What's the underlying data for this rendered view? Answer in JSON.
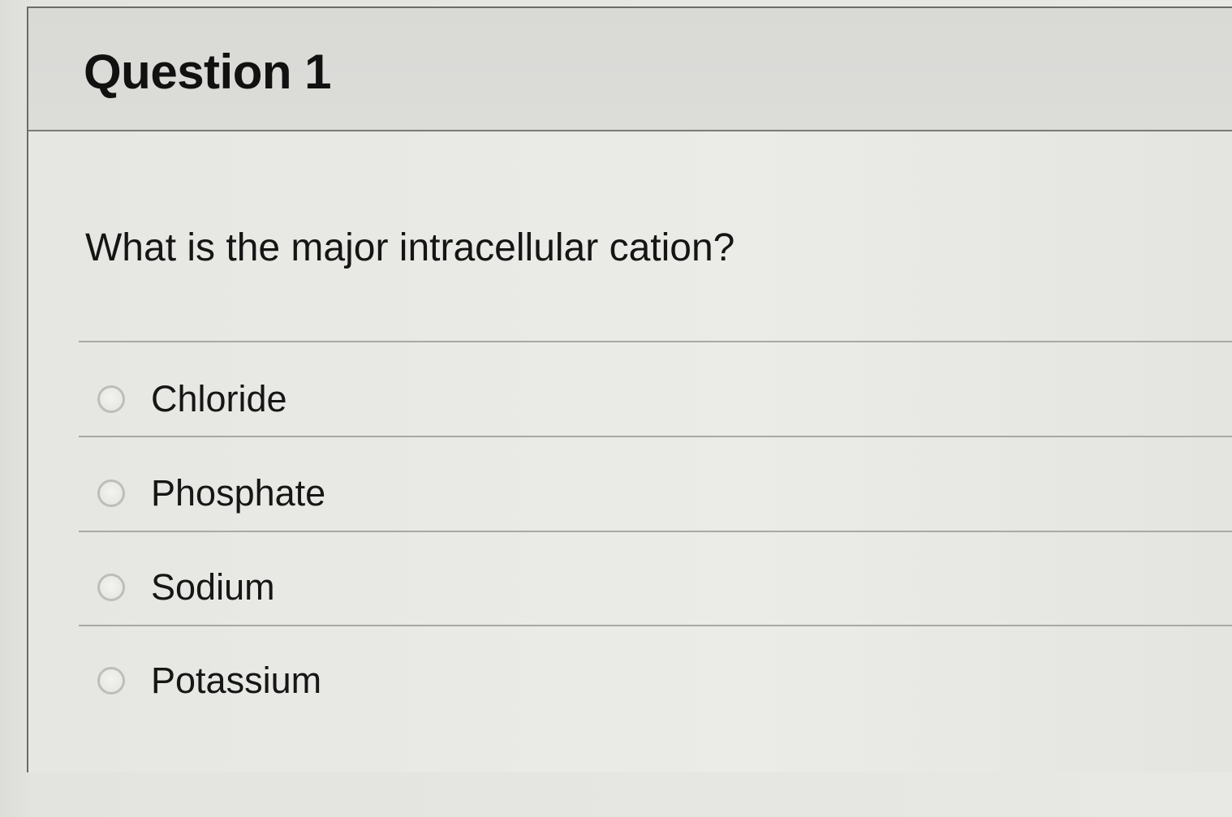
{
  "question": {
    "title": "Question 1",
    "prompt": "What is the major intracellular cation?"
  },
  "options": [
    {
      "label": "Chloride",
      "selected": false
    },
    {
      "label": "Phosphate",
      "selected": false
    },
    {
      "label": "Sodium",
      "selected": false
    },
    {
      "label": "Potassium",
      "selected": false
    }
  ]
}
